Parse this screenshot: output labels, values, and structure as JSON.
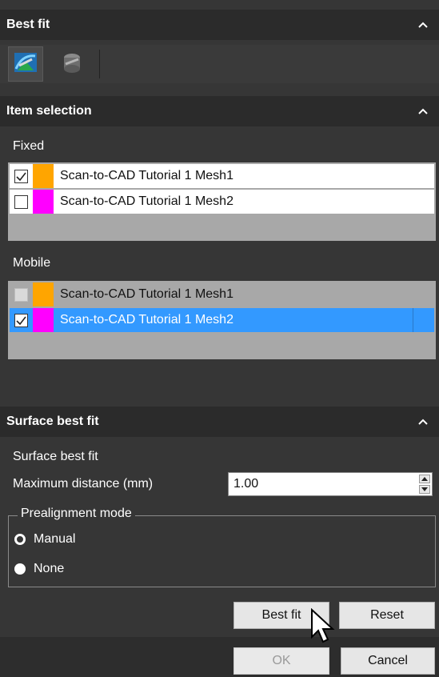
{
  "best_fit_section": {
    "title": "Best fit"
  },
  "toolbar": {
    "tools": [
      {
        "icon": "surface-best-fit-icon",
        "active": true
      },
      {
        "icon": "feature-best-fit-icon",
        "active": false
      }
    ]
  },
  "item_selection": {
    "title": "Item selection",
    "fixed": {
      "label": "Fixed",
      "items": [
        {
          "name": "Scan-to-CAD Tutorial 1 Mesh1",
          "checked": true,
          "color": "#ffa500"
        },
        {
          "name": "Scan-to-CAD Tutorial 1 Mesh2",
          "checked": false,
          "color": "#ff00ff"
        }
      ]
    },
    "mobile": {
      "label": "Mobile",
      "items": [
        {
          "name": "Scan-to-CAD Tutorial 1 Mesh1",
          "checked": false,
          "disabled": true,
          "color": "#ffa500"
        },
        {
          "name": "Scan-to-CAD Tutorial 1 Mesh2",
          "checked": true,
          "selected": true,
          "color": "#ff00ff"
        }
      ]
    }
  },
  "surface_best_fit": {
    "title": "Surface best fit",
    "subtitle": "Surface best fit",
    "max_distance_label": "Maximum distance (mm)",
    "max_distance_value": "1.00",
    "prealignment": {
      "legend": "Prealignment mode",
      "options": [
        {
          "label": "Manual",
          "selected": false
        },
        {
          "label": "None",
          "selected": true
        }
      ]
    }
  },
  "buttons": {
    "best_fit": "Best fit",
    "reset": "Reset",
    "ok": "OK",
    "cancel": "Cancel"
  },
  "colors": {
    "panel_bg": "#363636",
    "header_bg": "#2b2b2b",
    "selection_blue": "#3399ff",
    "orange_swatch": "#ffa500",
    "magenta_swatch": "#ff00ff"
  }
}
